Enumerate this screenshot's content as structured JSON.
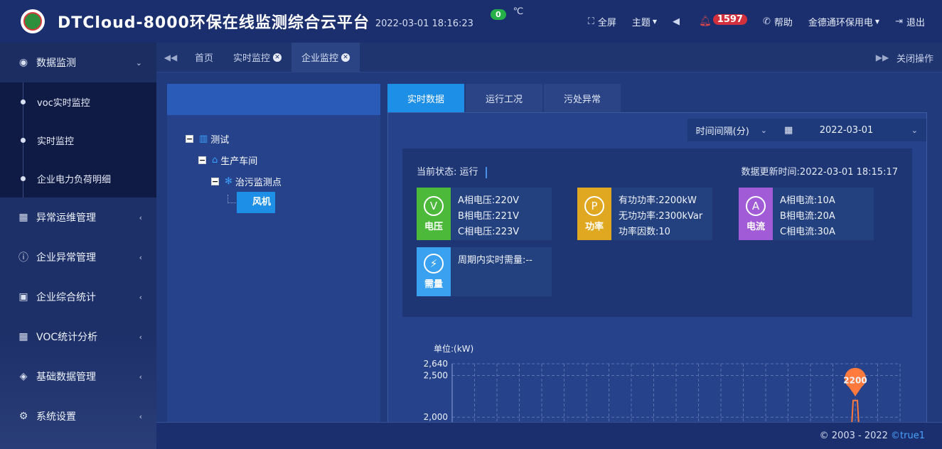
{
  "header": {
    "title": "DTCloud-8000环保在线监测综合云平台",
    "datetime": "2022-03-01  18:16:23",
    "temp_value": "0",
    "temp_unit": "℃",
    "fullscreen": "全屏",
    "theme": "主题",
    "alarm_count": "1597",
    "help": "帮助",
    "user": "金德通环保用电",
    "logout": "退出"
  },
  "sidebar": {
    "groups": [
      {
        "label": "数据监测",
        "icon": "droplet-icon"
      },
      {
        "label": "异常运维管理",
        "icon": "calendar-icon"
      },
      {
        "label": "企业异常管理",
        "icon": "alert-circle-icon"
      },
      {
        "label": "企业综合统计",
        "icon": "stats-icon"
      },
      {
        "label": "VOC统计分析",
        "icon": "calendar-icon"
      },
      {
        "label": "基础数据管理",
        "icon": "layers-icon"
      },
      {
        "label": "系统设置",
        "icon": "gear-icon"
      }
    ],
    "sub_items": [
      "voc实时监控",
      "实时监控",
      "企业电力负荷明细"
    ]
  },
  "tabs": {
    "items": [
      "首页",
      "实时监控",
      "企业监控"
    ],
    "close_ops": "关闭操作"
  },
  "tree": {
    "root": "测试",
    "level1": "生产车间",
    "level2": "治污监测点",
    "level3": "风机"
  },
  "panel_tabs": [
    "实时数据",
    "运行工况",
    "污处异常"
  ],
  "filters": {
    "interval": "时间间隔(分)",
    "date": "2022-03-01"
  },
  "status": {
    "current": "当前状态: 运行",
    "update_time": "数据更新时间:2022-03-01 18:15:17"
  },
  "cards": [
    {
      "label": "电压",
      "symbol": "V",
      "color": "#4cb93a",
      "lines": [
        "A相电压:220V",
        "B相电压:221V",
        "C相电压:223V"
      ]
    },
    {
      "label": "功率",
      "symbol": "P",
      "color": "#e0a820",
      "lines": [
        "有功功率:2200kW",
        "无功功率:2300kVar",
        "功率因数:10"
      ]
    },
    {
      "label": "电流",
      "symbol": "A",
      "color": "#a15bd6",
      "lines": [
        "A相电流:10A",
        "B相电流:20A",
        "C相电流:30A"
      ]
    },
    {
      "label": "需量",
      "symbol": "⚡",
      "color": "#3aa0f0",
      "lines": [
        "周期内实时需量:--"
      ]
    }
  ],
  "chart_data": {
    "type": "line",
    "ylabel": "单位:(kW)",
    "y_ticks": [
      2000,
      2500,
      2640
    ],
    "y_tick_labels": [
      "2,000",
      "2,500",
      "2,640"
    ],
    "ylim": [
      1900,
      2640
    ],
    "points": [
      {
        "x": "",
        "y": 2200
      }
    ],
    "marker_label": "2200",
    "marker_color": "#ff7a3c",
    "grid": true
  },
  "footer": {
    "copyright": "© 2003 - 2022 ",
    "brand": "©true1"
  }
}
